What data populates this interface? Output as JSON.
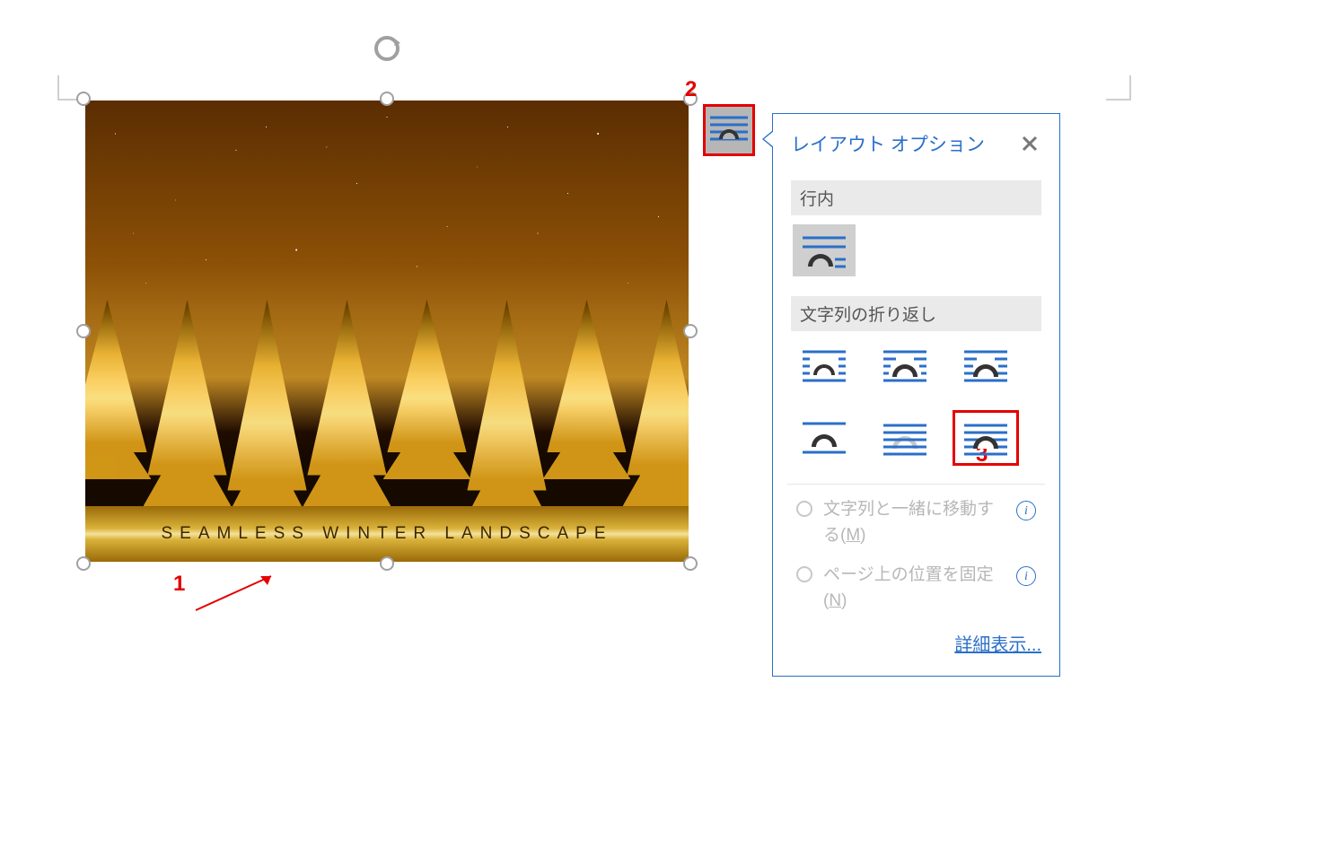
{
  "annotations": {
    "n1": "1",
    "n2": "2",
    "n3": "3"
  },
  "image": {
    "caption": "SEAMLESS WINTER LANDSCAPE"
  },
  "popup": {
    "title": "レイアウト オプション",
    "section_inline": "行内",
    "section_wrap": "文字列の折り返し",
    "radio_move": "文字列と一緒に移動する(",
    "radio_move_key": "M",
    "radio_move_tail": ")",
    "radio_fix": "ページ上の位置を固定(",
    "radio_fix_key": "N",
    "radio_fix_tail": ")",
    "more": "詳細表示..."
  }
}
